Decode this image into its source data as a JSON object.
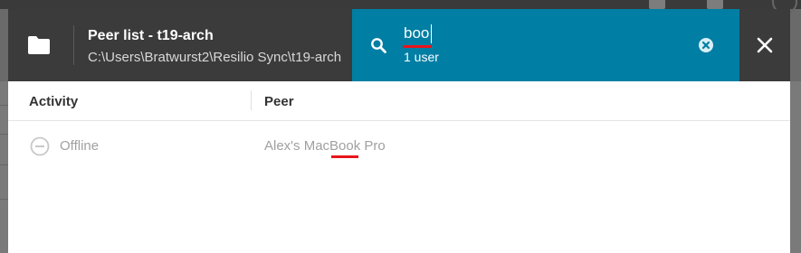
{
  "dialog": {
    "title": "Peer list - t19-arch",
    "path": "C:\\Users\\Bratwurst2\\Resilio Sync\\t19-arch"
  },
  "search": {
    "value": "boo",
    "result_count": "1 user"
  },
  "table": {
    "columns": [
      "Activity",
      "Peer"
    ],
    "rows": [
      {
        "activity": "Offline",
        "peer": "Alex's MacBook Pro"
      }
    ]
  },
  "colors": {
    "header": "#3b3b3b",
    "search_panel": "#007ea4",
    "highlight": "#e8151c",
    "muted_text": "#a0a0a0"
  },
  "icons": {
    "folder": "folder-icon",
    "search": "search-icon",
    "clear": "clear-search-icon",
    "close": "close-icon",
    "status": "offline-status-icon"
  }
}
